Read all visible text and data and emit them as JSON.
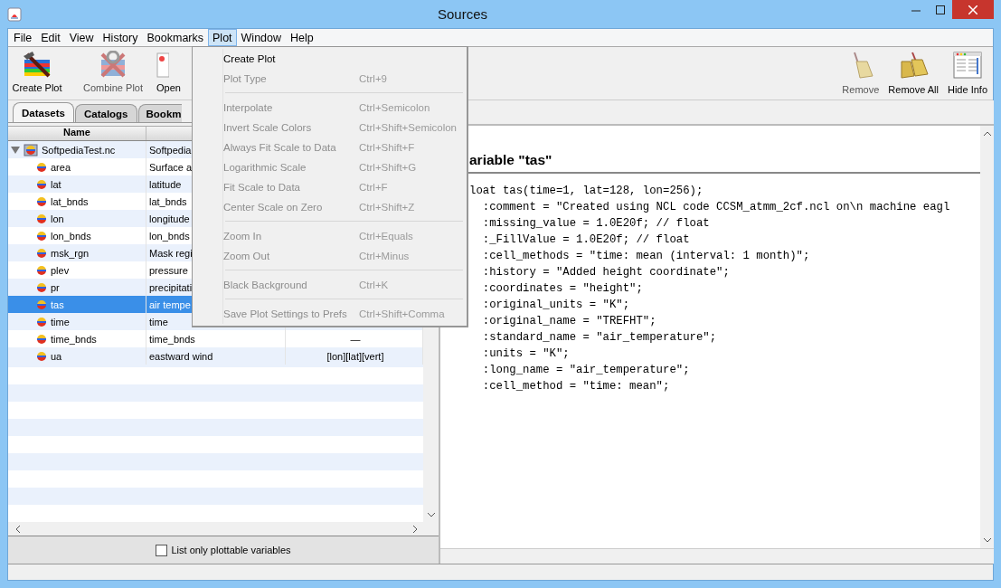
{
  "window": {
    "title": "Sources"
  },
  "menubar": [
    {
      "label": "File",
      "selected": false
    },
    {
      "label": "Edit",
      "selected": false
    },
    {
      "label": "View",
      "selected": false
    },
    {
      "label": "History",
      "selected": false
    },
    {
      "label": "Bookmarks",
      "selected": false
    },
    {
      "label": "Plot",
      "selected": true
    },
    {
      "label": "Window",
      "selected": false
    },
    {
      "label": "Help",
      "selected": false
    }
  ],
  "toolbar_left": [
    {
      "label": "Create Plot",
      "kind": "create",
      "disabled": false
    },
    {
      "label": "Combine Plot",
      "kind": "combine",
      "disabled": true
    },
    {
      "label": "Open",
      "kind": "open",
      "disabled": false
    }
  ],
  "toolbar_right": [
    {
      "label": "Remove",
      "kind": "broom",
      "disabled": true
    },
    {
      "label": "Remove All",
      "kind": "brooms",
      "disabled": false
    },
    {
      "label": "Hide Info",
      "kind": "info",
      "disabled": false
    }
  ],
  "tabs": [
    {
      "label": "Datasets",
      "selected": true
    },
    {
      "label": "Catalogs",
      "selected": false
    },
    {
      "label": "Bookm",
      "selected": false
    }
  ],
  "table": {
    "columns": [
      "Name"
    ],
    "rows": [
      {
        "name": "SoftpediaTest.nc",
        "kind": "file",
        "description": "Softpedia",
        "expanded": true,
        "selected": false,
        "children": [
          {
            "name": "area",
            "kind": "variable",
            "description": "Surface a",
            "selected": false
          },
          {
            "name": "lat",
            "kind": "variable",
            "description": "latitude",
            "selected": false
          },
          {
            "name": "lat_bnds",
            "kind": "variable",
            "description": "lat_bnds",
            "selected": false
          },
          {
            "name": "lon",
            "kind": "variable",
            "description": "longitude",
            "selected": false
          },
          {
            "name": "lon_bnds",
            "kind": "variable",
            "description": "lon_bnds",
            "selected": false
          },
          {
            "name": "msk_rgn",
            "kind": "variable",
            "description": "Mask regi",
            "selected": false
          },
          {
            "name": "plev",
            "kind": "variable",
            "description": "pressure",
            "selected": false
          },
          {
            "name": "pr",
            "kind": "variable",
            "description": "precipitati",
            "selected": false
          },
          {
            "name": "tas",
            "kind": "variable",
            "description": "air tempe",
            "selected": true
          },
          {
            "name": "time",
            "kind": "variable",
            "description": "time",
            "selected": false
          },
          {
            "name": "time_bnds",
            "kind": "variable",
            "description": "time_bnds",
            "shape": "—",
            "selected": false
          },
          {
            "name": "ua",
            "kind": "variable",
            "description": "eastward wind",
            "shape": "[lon][lat][vert]",
            "selected": false
          }
        ]
      }
    ]
  },
  "filter": {
    "label": "List only plottable variables",
    "checked": false
  },
  "info": {
    "heading": "ariable \"tas\"",
    "code": [
      "loat tas(time=1, lat=128, lon=256);",
      "  :comment = \"Created using NCL code CCSM_atmm_2cf.ncl on\\n machine eagl",
      "  :missing_value = 1.0E20f; // float",
      "  :_FillValue = 1.0E20f; // float",
      "  :cell_methods = \"time: mean (interval: 1 month)\";",
      "  :history = \"Added height coordinate\";",
      "  :coordinates = \"height\";",
      "  :original_units = \"K\";",
      "  :original_name = \"TREFHT\";",
      "  :standard_name = \"air_temperature\";",
      "  :units = \"K\";",
      "  :long_name = \"air_temperature\";",
      "  :cell_method = \"time: mean\";"
    ]
  },
  "plot_menu": [
    {
      "kind": "item",
      "label": "Create Plot",
      "disabled": false
    },
    {
      "kind": "item",
      "label": "Plot Type",
      "shortcut": "Ctrl+9",
      "disabled": true
    },
    {
      "kind": "separator"
    },
    {
      "kind": "item",
      "label": "Interpolate",
      "shortcut": "Ctrl+Semicolon",
      "disabled": true
    },
    {
      "kind": "item",
      "label": "Invert Scale Colors",
      "shortcut": "Ctrl+Shift+Semicolon",
      "disabled": true
    },
    {
      "kind": "item",
      "label": "Always Fit Scale to Data",
      "shortcut": "Ctrl+Shift+F",
      "disabled": true
    },
    {
      "kind": "item",
      "label": "Logarithmic Scale",
      "shortcut": "Ctrl+Shift+G",
      "disabled": true
    },
    {
      "kind": "item",
      "label": "Fit Scale to Data",
      "shortcut": "Ctrl+F",
      "disabled": true
    },
    {
      "kind": "item",
      "label": "Center Scale on Zero",
      "shortcut": "Ctrl+Shift+Z",
      "disabled": true
    },
    {
      "kind": "separator"
    },
    {
      "kind": "item",
      "label": "Zoom In",
      "shortcut": "Ctrl+Equals",
      "disabled": true
    },
    {
      "kind": "item",
      "label": "Zoom Out",
      "shortcut": "Ctrl+Minus",
      "disabled": true
    },
    {
      "kind": "separator"
    },
    {
      "kind": "item",
      "label": "Black Background",
      "shortcut": "Ctrl+K",
      "disabled": true
    },
    {
      "kind": "separator"
    },
    {
      "kind": "item",
      "label": "Save Plot Settings to Prefs",
      "shortcut": "Ctrl+Shift+Comma",
      "disabled": true
    }
  ]
}
